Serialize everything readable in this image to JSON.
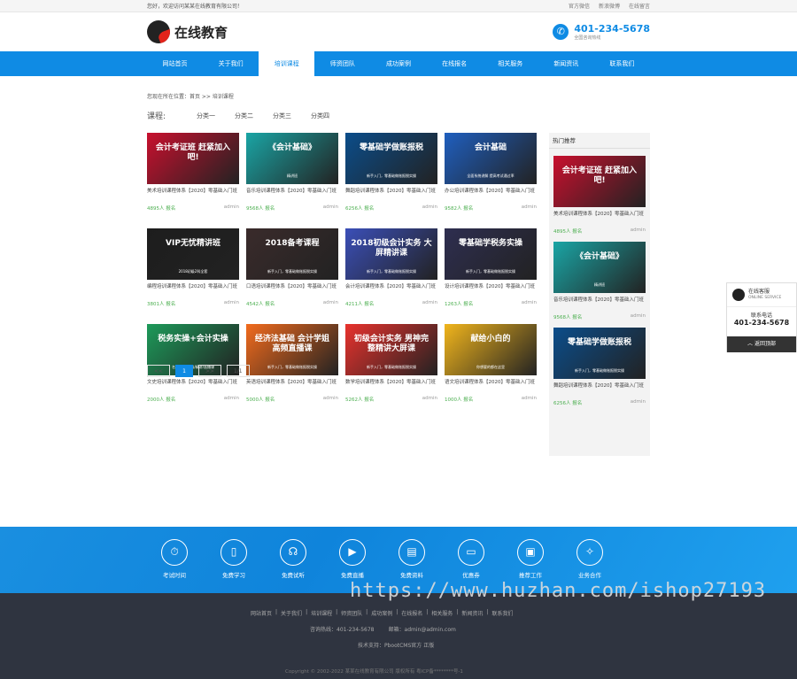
{
  "topbar": {
    "welcome": "您好，欢迎访问某某在线教育有限公司！",
    "links": [
      "官方微信",
      "新浪微博",
      "在线留言"
    ]
  },
  "header": {
    "logo_text": "在线教育",
    "hotline_number": "401-234-5678",
    "hotline_sub": "全国咨询热线"
  },
  "nav": {
    "items": [
      "网站首页",
      "关于我们",
      "培训课程",
      "师资团队",
      "成功案例",
      "在线报名",
      "相关服务",
      "新闻资讯",
      "联系我们"
    ],
    "active_index": 2
  },
  "breadcrumb": "您现在所在位置：首页 >> 培训课程",
  "filter": {
    "label": "课程:",
    "options": [
      "分类一",
      "分类二",
      "分类三",
      "分类四"
    ]
  },
  "courses": [
    {
      "banner": "会计考证班 赶紧加入吧!",
      "banner_sub": "",
      "color": "#c8102e",
      "title": "美术培训课程体系【2020】零基础入门班",
      "count": "4895人 报名",
      "author": "admin"
    },
    {
      "banner": "《会计基础》",
      "banner_sub": "精讲班",
      "color": "#1aa5a5",
      "title": "音乐培训课程体系【2020】零基础入门班",
      "count": "9568人 报名",
      "author": "admin"
    },
    {
      "banner": "零基础学做账报税",
      "banner_sub": "新手入门，零基础做账报税实操",
      "color": "#0b4d8a",
      "title": "舞蹈培训课程体系【2020】零基础入门班",
      "count": "6256人 报名",
      "author": "admin"
    },
    {
      "banner": "会计基础",
      "banner_sub": "全面系统讲解 提高考试通过率",
      "color": "#1f5fbf",
      "title": "办公培训课程体系【2020】零基础入门班",
      "count": "9582人 报名",
      "author": "admin"
    },
    {
      "banner": "VIP无忧精讲班",
      "banner_sub": "2018初级2科全套",
      "color": "#1d1d1d",
      "title": "编程培训课程体系【2020】零基础入门班",
      "count": "3801人 报名",
      "author": "admin"
    },
    {
      "banner": "2018备考课程",
      "banner_sub": "新手入门，零基础做账报税实操",
      "color": "#3a2b2b",
      "title": "口语培训课程体系【2020】零基础入门班",
      "count": "4542人 报名",
      "author": "admin"
    },
    {
      "banner": "2018初级会计实务 大屏精讲课",
      "banner_sub": "新手入门，零基础做账报税实操",
      "color": "#3b4fb8",
      "title": "会计培训课程体系【2020】零基础入门班",
      "count": "4211人 报名",
      "author": "admin"
    },
    {
      "banner": "零基础学税务实操",
      "banner_sub": "新手入门，零基础做账报税实操",
      "color": "#2e2e50",
      "title": "设计培训课程体系【2020】零基础入门班",
      "count": "1263人 报名",
      "author": "admin"
    },
    {
      "banner": "税务实操+会计实操",
      "banner_sub": "名师授课/高效/精讲/直播课",
      "color": "#1d9a5a",
      "title": "文史培训课程体系【2020】零基础入门班",
      "count": "2000人 报名",
      "author": "admin"
    },
    {
      "banner": "经济法基础 会计学姐高频直播课",
      "banner_sub": "新手入门，零基础做账报税实操",
      "color": "#f26b1d",
      "title": "英语培训课程体系【2020】零基础入门班",
      "count": "5000人 报名",
      "author": "admin"
    },
    {
      "banner": "初级会计实务 男神完整精讲大屏课",
      "banner_sub": "新手入门，零基础做账报税实操",
      "color": "#e8322d",
      "title": "数学培训课程体系【2020】零基础入门班",
      "count": "5262人 报名",
      "author": "admin"
    },
    {
      "banner": "献给小白的",
      "banner_sub": "你想要的都在这里",
      "color": "#f1b51c",
      "title": "语文培训课程体系【2020】零基础入门班",
      "count": "1000人 报名",
      "author": "admin"
    }
  ],
  "pagination": {
    "prev": "<<",
    "current": "1",
    "next": ">>",
    "summary": "1/1"
  },
  "sidebar": {
    "title": "热门推荐",
    "items": [
      {
        "banner": "会计考证班 赶紧加入吧!",
        "banner_sub": "",
        "color": "#c8102e",
        "title": "美术培训课程体系【2020】零基础入门班",
        "count": "4895人 报名",
        "author": "admin"
      },
      {
        "banner": "《会计基础》",
        "banner_sub": "精讲班",
        "color": "#1aa5a5",
        "title": "音乐培训课程体系【2020】零基础入门班",
        "count": "9568人 报名",
        "author": "admin"
      },
      {
        "banner": "零基础学做账报税",
        "banner_sub": "新手入门，零基础做账报税实操",
        "color": "#0b4d8a",
        "title": "舞蹈培训课程体系【2020】零基础入门班",
        "count": "6256人 报名",
        "author": "admin"
      }
    ]
  },
  "float_widget": {
    "qq_title": "在线客服",
    "qq_sub": "ONLINE SERVICE",
    "tel_label": "联系电话",
    "tel_number": "401-234-5678",
    "back_top": "返回顶部"
  },
  "services": [
    {
      "icon": "clock-icon",
      "glyph": "⏱",
      "label": "考试时间"
    },
    {
      "icon": "book-icon",
      "glyph": "▯",
      "label": "免费学习"
    },
    {
      "icon": "headset-icon",
      "glyph": "☊",
      "label": "免费试听"
    },
    {
      "icon": "video-icon",
      "glyph": "▶",
      "label": "免费直播"
    },
    {
      "icon": "document-icon",
      "glyph": "▤",
      "label": "免费资料"
    },
    {
      "icon": "coupon-icon",
      "glyph": "▭",
      "label": "优惠券"
    },
    {
      "icon": "briefcase-icon",
      "glyph": "▣",
      "label": "推荐工作"
    },
    {
      "icon": "handshake-icon",
      "glyph": "✧",
      "label": "业务合作"
    }
  ],
  "footer": {
    "links": [
      "网站首页",
      "关于我们",
      "培训课程",
      "师资团队",
      "成功案例",
      "在线报名",
      "相关服务",
      "新闻资讯",
      "联系我们"
    ],
    "phone": "咨询热线：401-234-5678",
    "email": "邮箱：admin@admin.com",
    "support": "技术支持：PbootCMS官方 正版",
    "copyright": "Copyright © 2002-2022 某某在线教育有限公司 版权所有  粤ICP备********号-1"
  },
  "watermark": "https://www.huzhan.com/ishop27193"
}
